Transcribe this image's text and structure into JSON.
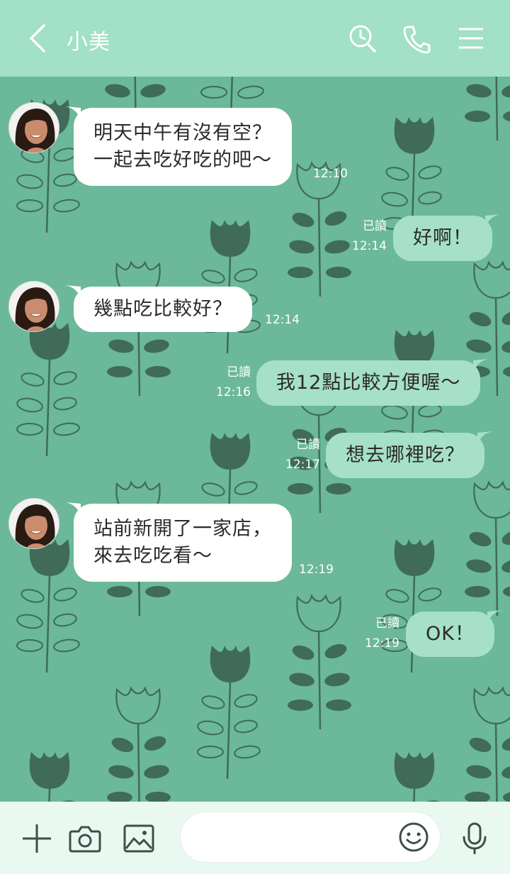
{
  "header": {
    "title": "小美",
    "icons": [
      "back-icon",
      "search-history-icon",
      "phone-icon",
      "menu-icon"
    ]
  },
  "messages": [
    {
      "side": "in",
      "lines": [
        "明天中午有沒有空？",
        "一起去吃好吃的吧～"
      ],
      "time": "12:10"
    },
    {
      "side": "out",
      "lines": [
        "好啊！"
      ],
      "read": "已讀",
      "time": "12:14"
    },
    {
      "side": "in",
      "lines": [
        "幾點吃比較好？"
      ],
      "time": "12:14"
    },
    {
      "side": "out",
      "lines": [
        "我12點比較方便喔～"
      ],
      "read": "已讀",
      "time": "12:16"
    },
    {
      "side": "out",
      "lines": [
        "想去哪裡吃？"
      ],
      "read": "已讀",
      "time": "12:17"
    },
    {
      "side": "in",
      "lines": [
        "站前新開了一家店，",
        "來去吃吃看～"
      ],
      "time": "12:19"
    },
    {
      "side": "out",
      "lines": [
        "OK！"
      ],
      "read": "已讀",
      "time": "12:19"
    }
  ],
  "footer": {
    "icons": [
      "plus-icon",
      "camera-icon",
      "image-icon",
      "emoji-icon",
      "microphone-icon"
    ],
    "input_value": ""
  },
  "colors": {
    "header_bg": "#a2e0c8",
    "chat_bg": "#6bb89a",
    "outgoing_bubble": "#a6e0c8",
    "incoming_bubble": "#ffffff",
    "footer_bg": "#eaf8f2",
    "pattern_dark": "#3f6b58"
  }
}
